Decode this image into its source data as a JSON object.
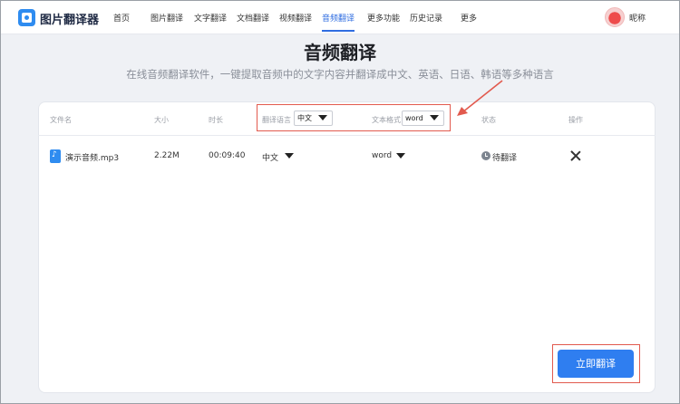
{
  "header": {
    "brand": "图片翻译器",
    "nav": [
      "首页",
      "图片翻译",
      "文字翻译",
      "文档翻译",
      "视频翻译",
      "音频翻译",
      "更多功能",
      "历史记录",
      "更多"
    ],
    "active_nav": "音频翻译",
    "user_name": "昵称"
  },
  "main": {
    "title": "音频翻译",
    "subtitle": "在线音频翻译软件，一键提取音频中的文字内容并翻译成中文、英语、日语、韩语等多种语言"
  },
  "table": {
    "headers": {
      "file_name": "文件名",
      "size": "大小",
      "duration": "时长",
      "translate_lang": "翻译语言",
      "text_format": "文本格式",
      "status": "状态",
      "action": "操作"
    },
    "global_lang_select": "中文",
    "global_format_select": "word",
    "rows": [
      {
        "file_name": "演示音频.mp3",
        "size": "2.22M",
        "duration": "00:09:40",
        "lang": "中文",
        "format": "word",
        "status": "待翻译"
      }
    ]
  },
  "actions": {
    "translate_now": "立即翻译"
  },
  "colors": {
    "accent": "#2f7ef0",
    "highlight": "#e25a4e"
  }
}
